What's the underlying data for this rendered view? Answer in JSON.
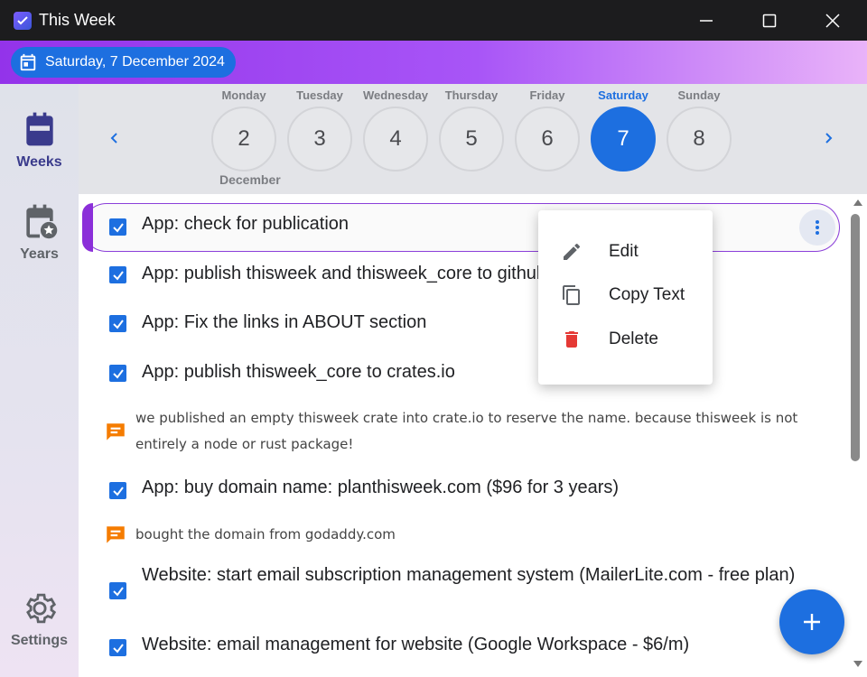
{
  "window": {
    "title": "This Week"
  },
  "header": {
    "date_label": "Saturday, 7 December 2024"
  },
  "sidebar": {
    "items": [
      {
        "label": "Weeks",
        "icon": "calendar-icon",
        "active": true
      },
      {
        "label": "Years",
        "icon": "calendar-star-icon",
        "active": false
      }
    ],
    "settings_label": "Settings"
  },
  "week": {
    "month_label": "December",
    "days": [
      {
        "name": "Monday",
        "number": "2",
        "selected": false
      },
      {
        "name": "Tuesday",
        "number": "3",
        "selected": false
      },
      {
        "name": "Wednesday",
        "number": "4",
        "selected": false
      },
      {
        "name": "Thursday",
        "number": "5",
        "selected": false
      },
      {
        "name": "Friday",
        "number": "6",
        "selected": false
      },
      {
        "name": "Saturday",
        "number": "7",
        "selected": true
      },
      {
        "name": "Sunday",
        "number": "8",
        "selected": false
      }
    ]
  },
  "tasks": [
    {
      "type": "task",
      "checked": true,
      "text": "App: check for publication"
    },
    {
      "type": "task",
      "checked": true,
      "text": "App: publish thisweek and thisweek_core to github"
    },
    {
      "type": "task",
      "checked": true,
      "text": "App: Fix the links in ABOUT section"
    },
    {
      "type": "task",
      "checked": true,
      "text": "App: publish thisweek_core to crates.io"
    },
    {
      "type": "note",
      "text": "we published an empty thisweek crate into crate.io to reserve the name. because thisweek is not entirely a node or rust package!"
    },
    {
      "type": "task",
      "checked": true,
      "text": "App: buy domain name: planthisweek.com ($96 for 3 years)"
    },
    {
      "type": "note",
      "text": "bought the domain from godaddy.com"
    },
    {
      "type": "task",
      "checked": true,
      "text": "Website: start email subscription management system (MailerLite.com - free plan)"
    },
    {
      "type": "task",
      "checked": true,
      "text": "Website: email management for website (Google Workspace - $6/m)"
    }
  ],
  "context_menu": {
    "items": [
      {
        "label": "Edit",
        "icon": "pencil-icon"
      },
      {
        "label": "Copy Text",
        "icon": "copy-icon"
      },
      {
        "label": "Delete",
        "icon": "trash-icon"
      }
    ]
  },
  "colors": {
    "accent": "#1d6fe0",
    "highlight": "#8b2fd9",
    "note": "#f57c00",
    "delete": "#e53935"
  }
}
